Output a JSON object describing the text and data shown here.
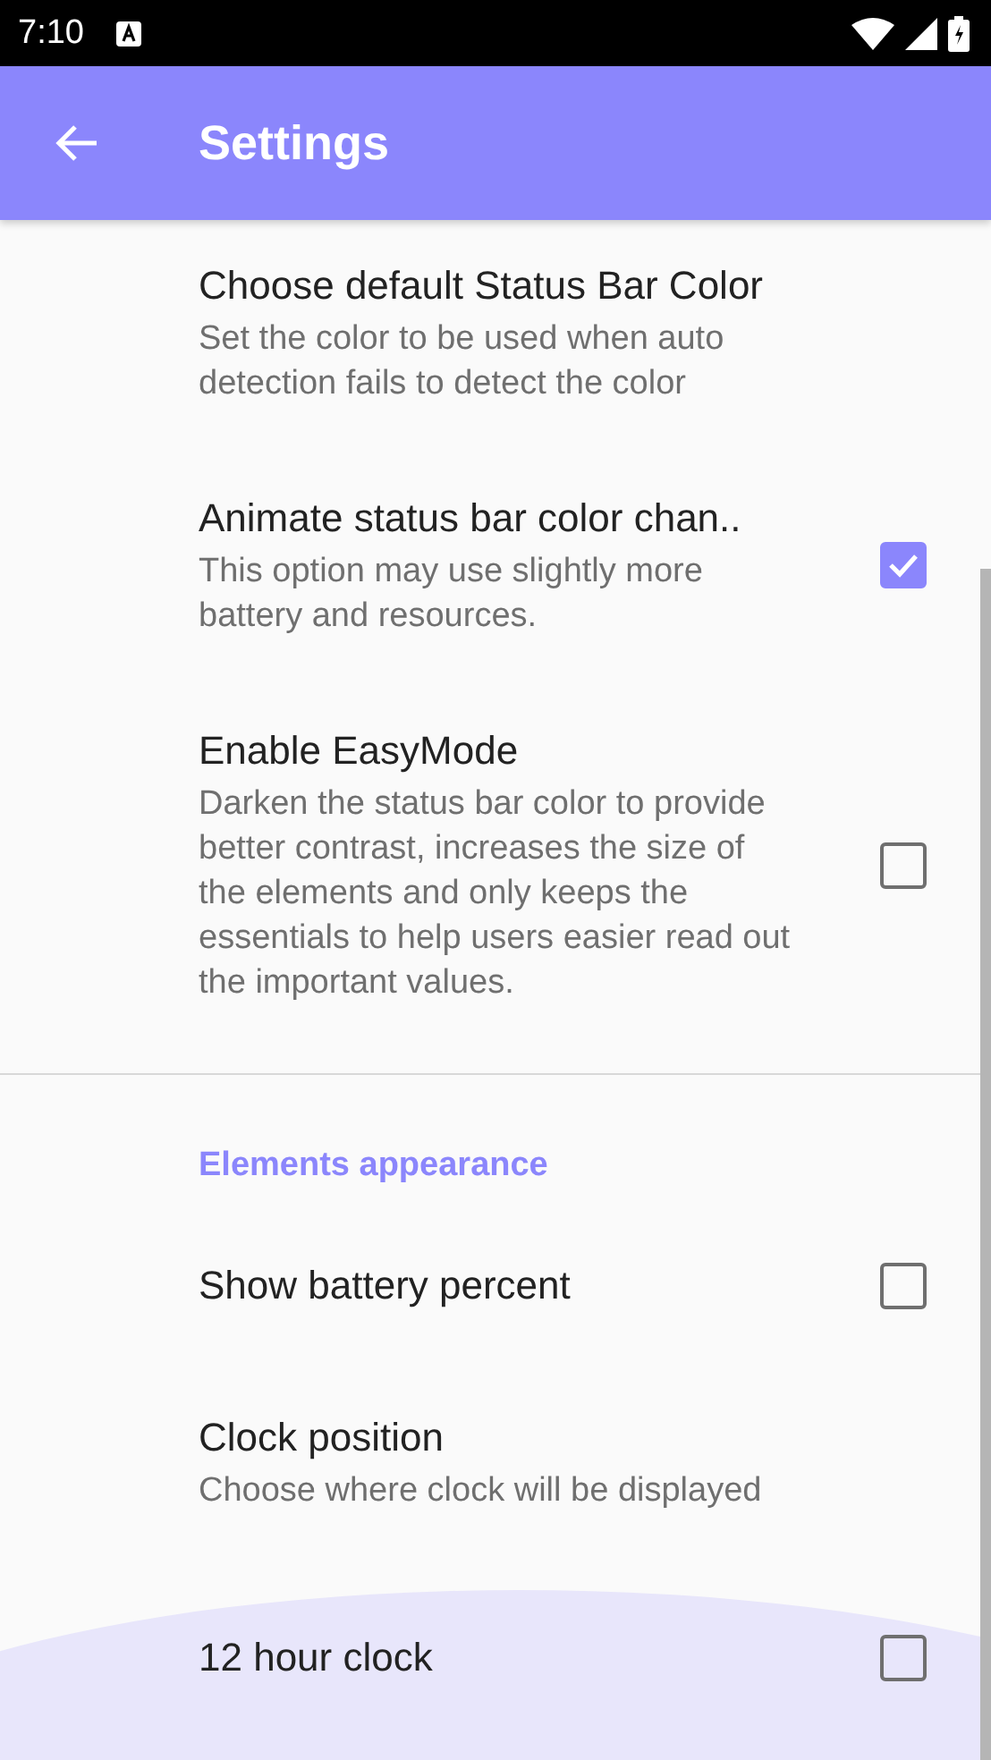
{
  "status_bar": {
    "time": "7:10"
  },
  "app_bar": {
    "title": "Settings"
  },
  "items": [
    {
      "kind": "text",
      "title": "Choose default Status Bar Color",
      "summary": "Set the color to be used when auto detection fails to detect the color"
    },
    {
      "kind": "checkbox",
      "title": "Animate status bar color chan..",
      "summary": "This option may use slightly more battery and resources.",
      "checked": true
    },
    {
      "kind": "checkbox",
      "title": "Enable EasyMode",
      "summary": "Darken the status bar color to provide better contrast, increases the size of the elements and only keeps the essentials to help users easier read out the important values.",
      "checked": false
    },
    {
      "kind": "divider"
    },
    {
      "kind": "category",
      "title": "Elements appearance"
    },
    {
      "kind": "checkbox",
      "title": "Show battery percent",
      "checked": false
    },
    {
      "kind": "text",
      "title": "Clock position",
      "summary": "Choose where clock will be displayed"
    },
    {
      "kind": "checkbox",
      "title": "12 hour clock",
      "checked": false,
      "pressed": true
    }
  ]
}
